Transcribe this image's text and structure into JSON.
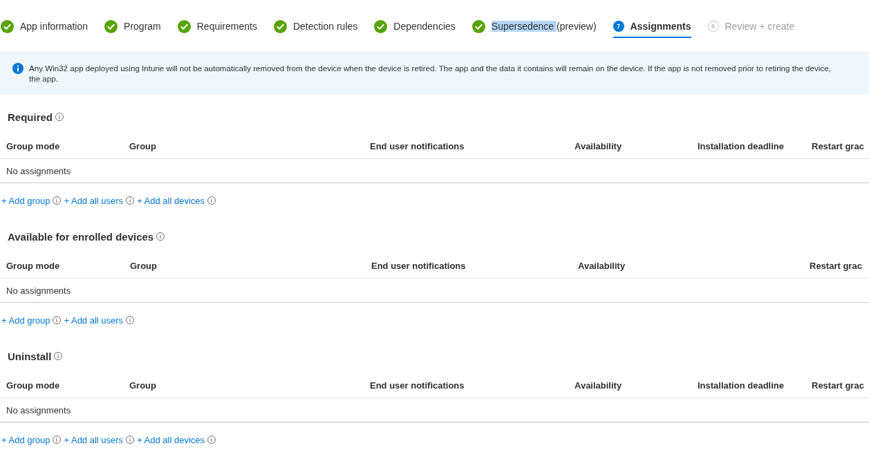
{
  "steps": [
    {
      "kind": "done",
      "label": "App information",
      "selected": false
    },
    {
      "kind": "done",
      "label": "Program",
      "selected": false
    },
    {
      "kind": "done",
      "label": "Requirements",
      "selected": false
    },
    {
      "kind": "done",
      "label": "Detection rules",
      "selected": false
    },
    {
      "kind": "done",
      "label": "Dependencies",
      "selected": false
    },
    {
      "kind": "done",
      "highlighted_text": "Supersedence ",
      "label": "(preview)",
      "selected": false
    },
    {
      "kind": "current",
      "number": "7",
      "label": "Assignments",
      "selected": true
    },
    {
      "kind": "pending",
      "number": "8",
      "label": "Review + create",
      "selected": false
    }
  ],
  "info_banner": {
    "lines": [
      "Any Win32 app deployed using Intune will not be automatically removed from the device when the device is retired. The app and the data it contains will remain on the device. If the app is not removed prior to retiring the device,",
      "the app."
    ]
  },
  "sections": [
    {
      "title": "Required",
      "columns": [
        "Group mode",
        "Group",
        "End user notifications",
        "Availability",
        "Installation deadline",
        "Restart grac"
      ],
      "empty_message": "No assignments",
      "links": [
        "+ Add group",
        "+ Add all users",
        "+ Add all devices"
      ]
    },
    {
      "title": "Available for enrolled devices",
      "columns": [
        "Group mode",
        "Group",
        "End user notifications",
        "Availability",
        "Restart grac"
      ],
      "empty_message": "No assignments",
      "links": [
        "+ Add group",
        "+ Add all users"
      ]
    },
    {
      "title": "Uninstall",
      "columns": [
        "Group mode",
        "Group",
        "End user notifications",
        "Availability",
        "Installation deadline",
        "Restart grac"
      ],
      "empty_message": "No assignments",
      "links": [
        "+ Add group",
        "+ Add all users",
        "+ Add all devices"
      ]
    }
  ]
}
